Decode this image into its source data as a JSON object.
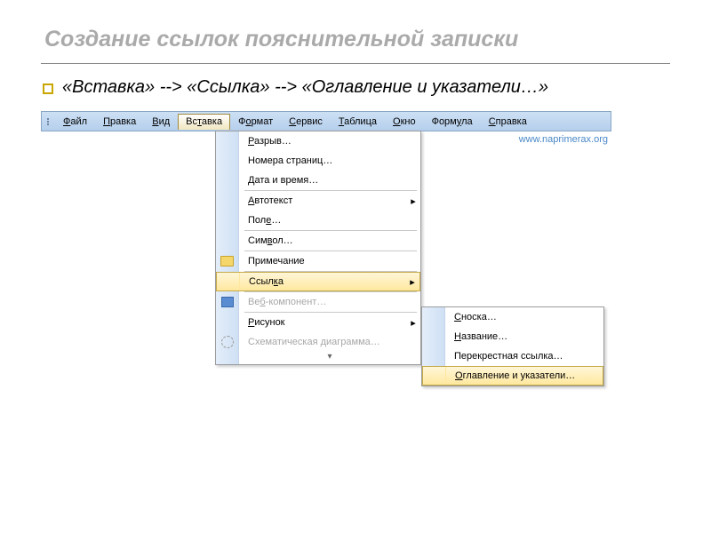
{
  "slide": {
    "title": "Создание ссылок пояснительной записки",
    "instruction": "«Вставка» --> «Ссылка» --> «Оглавление и указатели…»"
  },
  "watermark": "www.naprimerax.org",
  "menubar": [
    {
      "label": "Файл",
      "u": 0
    },
    {
      "label": "Правка",
      "u": 0
    },
    {
      "label": "Вид",
      "u": 0
    },
    {
      "label": "Вставка",
      "u": 2,
      "active": true
    },
    {
      "label": "Формат",
      "u": 1
    },
    {
      "label": "Сервис",
      "u": 0
    },
    {
      "label": "Таблица",
      "u": 0
    },
    {
      "label": "Окно",
      "u": 0
    },
    {
      "label": "Формула",
      "u": 4
    },
    {
      "label": "Справка",
      "u": 0
    }
  ],
  "dropdown": {
    "items": [
      {
        "label": "Разрыв…",
        "u_char": "Р"
      },
      {
        "label": "Номера страниц…"
      },
      {
        "label": "Дата и время…",
        "u_char": "Д"
      },
      {
        "type": "sep"
      },
      {
        "label": "Автотекст",
        "u_char": "А",
        "submenu": true
      },
      {
        "label": "Поле…",
        "u_char": "е"
      },
      {
        "type": "sep"
      },
      {
        "label": "Символ…",
        "u_char": "в"
      },
      {
        "type": "sep"
      },
      {
        "label": "Примечание",
        "icon": "folder"
      },
      {
        "type": "sep"
      },
      {
        "label": "Ссылка",
        "u_char": "к",
        "submenu": true,
        "hover": true
      },
      {
        "type": "sep"
      },
      {
        "label": "Веб-компонент…",
        "u_char": "б",
        "disabled": true,
        "icon": "blue"
      },
      {
        "type": "sep"
      },
      {
        "label": "Рисунок",
        "u_char": "Р",
        "submenu": true
      },
      {
        "label": "Схематическая диаграмма…",
        "icon": "circle",
        "disabled": true
      },
      {
        "type": "expand"
      }
    ]
  },
  "submenu": {
    "items": [
      {
        "label": "Сноска…",
        "u_char": "С"
      },
      {
        "label": "Название…",
        "u_char": "Н"
      },
      {
        "label": "Перекрестная ссылка…"
      },
      {
        "label": "Оглавление и указатели…",
        "u_char": "О",
        "hover": true
      }
    ]
  }
}
